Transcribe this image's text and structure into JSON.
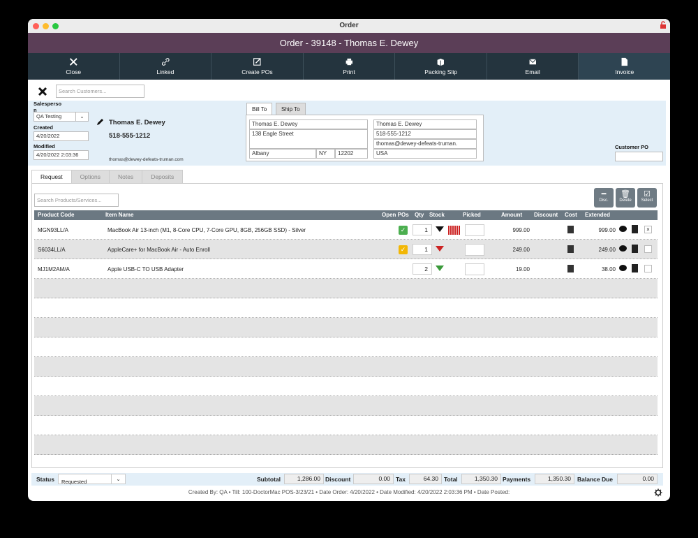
{
  "window_title": "Order",
  "header_title": "Order - 39148 - Thomas E.  Dewey",
  "toolbar": [
    {
      "label": "Close",
      "icon": "close-icon"
    },
    {
      "label": "Linked",
      "icon": "link-icon"
    },
    {
      "label": "Create POs",
      "icon": "edit-icon"
    },
    {
      "label": "Print",
      "icon": "print-icon"
    },
    {
      "label": "Packing Slip",
      "icon": "box-icon"
    },
    {
      "label": "Email",
      "icon": "email-icon"
    },
    {
      "label": "Invoice",
      "icon": "document-icon"
    }
  ],
  "customer_search_placeholder": "Search Customers...",
  "sidebar": {
    "salesperson_label": "Salesperso n",
    "salesperson_value": "QA Testing",
    "created_label": "Created",
    "created_value": "4/20/2022",
    "modified_label": "Modified",
    "modified_value": "4/20/2022 2:03:36"
  },
  "customer": {
    "name": "Thomas E.  Dewey",
    "phone": "518-555-1212",
    "email": "thomas@dewey-defeats-truman.com"
  },
  "address_tabs": [
    "Bill To",
    "Ship To"
  ],
  "bill_to": {
    "name": "Thomas E.  Dewey",
    "street": "138 Eagle Street",
    "city": "Albany",
    "state": "NY",
    "zip": "12202"
  },
  "bill_contact": {
    "name": "Thomas E.  Dewey",
    "phone": "518-555-1212",
    "email": "thomas@dewey-defeats-truman.",
    "country": "USA"
  },
  "customer_po_label": "Customer PO",
  "tabs": [
    "Request",
    "Options",
    "Notes",
    "Deposits"
  ],
  "product_search_placeholder": "Search Products/Services...",
  "action_buttons": [
    {
      "label": "Disc.",
      "icon": "minus-icon"
    },
    {
      "label": "Delete",
      "icon": "trash-icon"
    },
    {
      "label": "Select",
      "icon": "checkbox-icon"
    }
  ],
  "columns": {
    "code": "Product Code",
    "name": "Item Name",
    "open_pos": "Open POs",
    "qty": "Qty",
    "stock": "Stock",
    "picked": "Picked",
    "amount": "Amount",
    "discount": "Discount",
    "cost": "Cost",
    "extended": "Extended"
  },
  "items": [
    {
      "code": "MGN93LL/A",
      "name": "MacBook Air 13-inch (M1, 8-Core CPU, 7-Core GPU, 8GB, 256GB SSD) - Silver",
      "qty": "1",
      "amount": "999.00",
      "extended": "999.00",
      "po_color": "#4caf50",
      "stock_color": "#111111"
    },
    {
      "code": "S6034LL/A",
      "name": "AppleCare+ for MacBook Air - Auto Enroll",
      "qty": "1",
      "amount": "249.00",
      "extended": "249.00",
      "po_color": "#f2b705",
      "stock_color": "#cc2222"
    },
    {
      "code": "MJ1M2AM/A",
      "name": "Apple USB-C TO USB Adapter",
      "qty": "2",
      "amount": "19.00",
      "extended": "38.00",
      "po_color": "",
      "stock_color": "#3a9a3a"
    }
  ],
  "footer": {
    "status_label": "Status",
    "status_value": "Requested",
    "subtotal_label": "Subtotal",
    "subtotal": "1,286.00",
    "discount_label": "Discount",
    "discount": "0.00",
    "tax_label": "Tax",
    "tax": "64.30",
    "total_label": "Total",
    "total": "1,350.30",
    "payments_label": "Payments",
    "payments": "1,350.30",
    "balance_label": "Balance Due",
    "balance": "0.00"
  },
  "status_line": "Created By: QA • Till: 100-DoctorMac POS-3/23/21 • Date Order: 4/20/2022 • Date Modified: 4/20/2022 2:03:36 PM • Date Posted:"
}
